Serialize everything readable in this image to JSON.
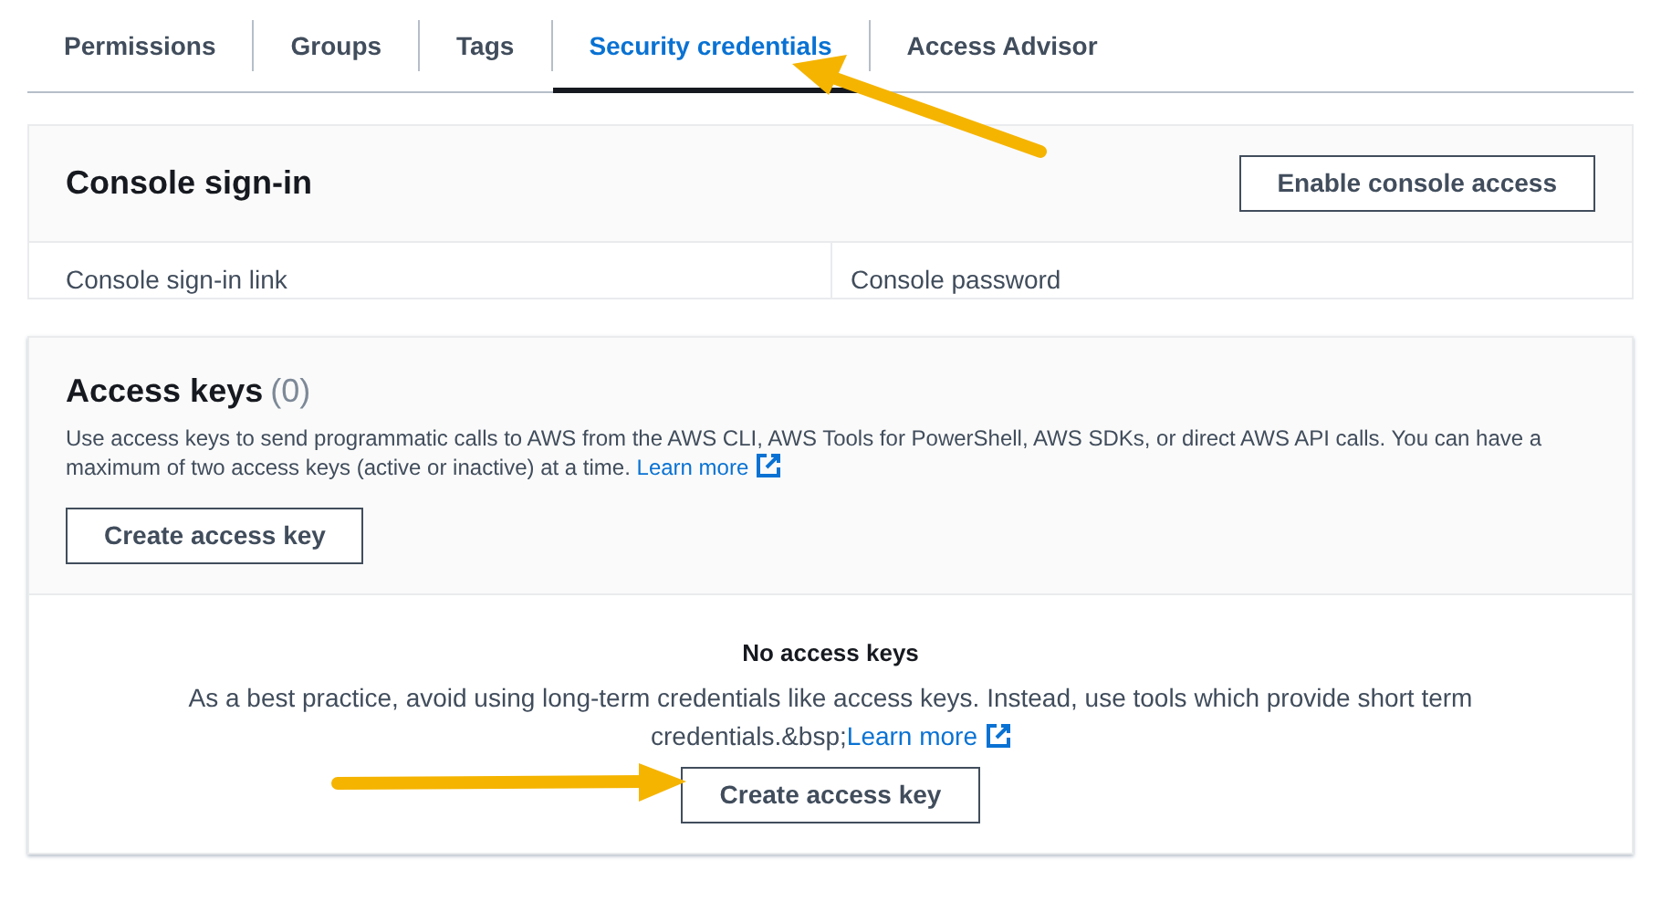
{
  "tabs": [
    {
      "label": "Permissions",
      "selected": false
    },
    {
      "label": "Groups",
      "selected": false
    },
    {
      "label": "Tags",
      "selected": false
    },
    {
      "label": "Security credentials",
      "selected": true
    },
    {
      "label": "Access Advisor",
      "selected": false
    }
  ],
  "console_signin": {
    "title": "Console sign-in",
    "button": "Enable console access",
    "columns": [
      "Console sign-in link",
      "Console password"
    ]
  },
  "access_keys": {
    "title": "Access keys",
    "count": "(0)",
    "description": "Use access keys to send programmatic calls to AWS from the AWS CLI, AWS Tools for PowerShell, AWS SDKs, or direct AWS API calls. You can have a maximum of two access keys (active or inactive) at a time.",
    "learn_more": "Learn more",
    "button": "Create access key",
    "empty": {
      "title": "No access keys",
      "description": "As a best practice, avoid using long-term credentials like access keys. Instead, use tools which provide short term credentials.&bsp;",
      "learn_more": "Learn more",
      "button": "Create access key"
    }
  }
}
